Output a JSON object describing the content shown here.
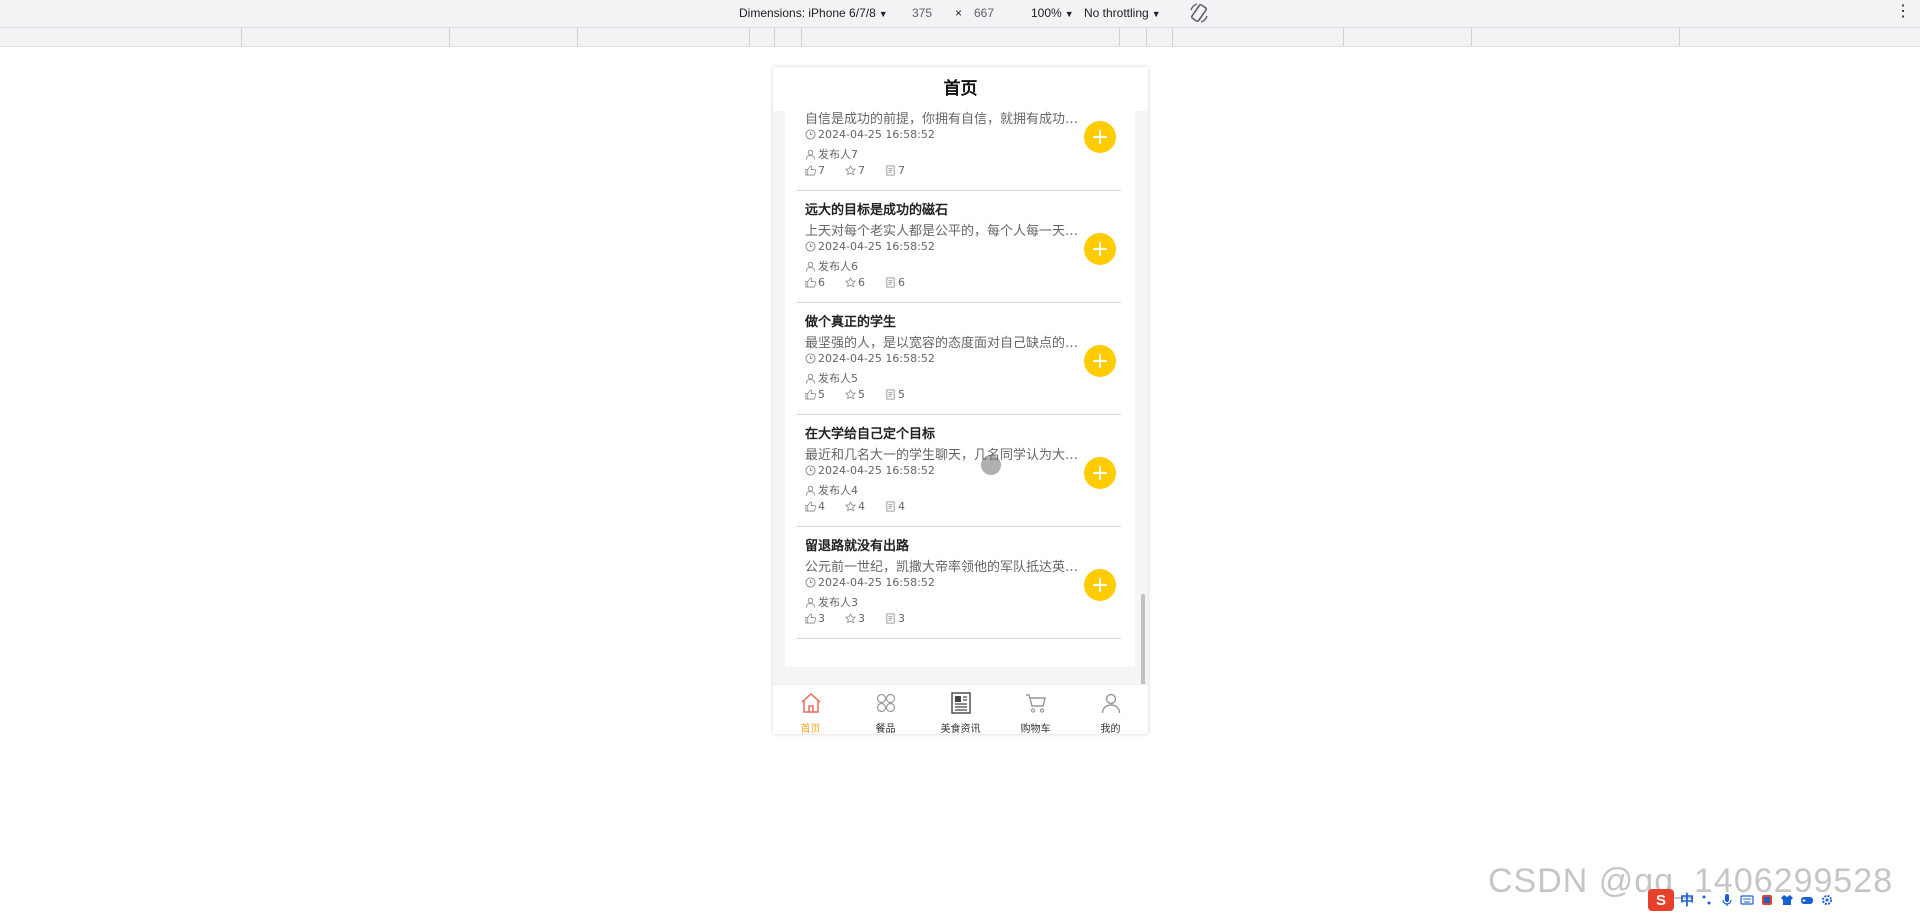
{
  "devtools": {
    "dimensions_label": "Dimensions: iPhone 6/7/8",
    "width": "375",
    "times": "×",
    "height": "667",
    "zoom": "100%",
    "throttling": "No throttling",
    "more_icon": "⋮"
  },
  "page": {
    "title": "首页"
  },
  "news": [
    {
      "title": "",
      "summary": "自信是成功的前提，你拥有自信，就拥有成功的一半。",
      "time": "2024-04-25 16:58:52",
      "author": "发布人7",
      "likes": "7",
      "favorites": "7",
      "comments": "7"
    },
    {
      "title": "远大的目标是成功的磁石",
      "summary": "上天对每个老实人都是公平的，每个人每一天都拥有同样的时间。",
      "time": "2024-04-25 16:58:52",
      "author": "发布人6",
      "likes": "6",
      "favorites": "6",
      "comments": "6"
    },
    {
      "title": "做个真正的学生",
      "summary": "最坚强的人，是以宽容的态度面对自己缺点的人。",
      "time": "2024-04-25 16:58:52",
      "author": "发布人5",
      "likes": "5",
      "favorites": "5",
      "comments": "5"
    },
    {
      "title": "在大学给自己定个目标",
      "summary": "最近和几名大一的学生聊天，几名同学认为大学生活很迷茫。",
      "time": "2024-04-25 16:58:52",
      "author": "发布人4",
      "likes": "4",
      "favorites": "4",
      "comments": "4"
    },
    {
      "title": "留退路就没有出路",
      "summary": "公元前一世纪，凯撒大帝率领他的军队抵达英格兰。",
      "time": "2024-04-25 16:58:52",
      "author": "发布人3",
      "likes": "3",
      "favorites": "3",
      "comments": "3"
    }
  ],
  "tabbar": {
    "home": "首页",
    "dishes": "餐品",
    "food_news": "美食资讯",
    "cart": "购物车",
    "mine": "我的"
  },
  "watermark": "CSDN @qq_1406299528",
  "ime": {
    "logo": "S",
    "lang": "中"
  },
  "colors": {
    "accent_yellow": "#ffcc00",
    "active_tab": "#f5a623",
    "divider": "#d9d9d9"
  }
}
